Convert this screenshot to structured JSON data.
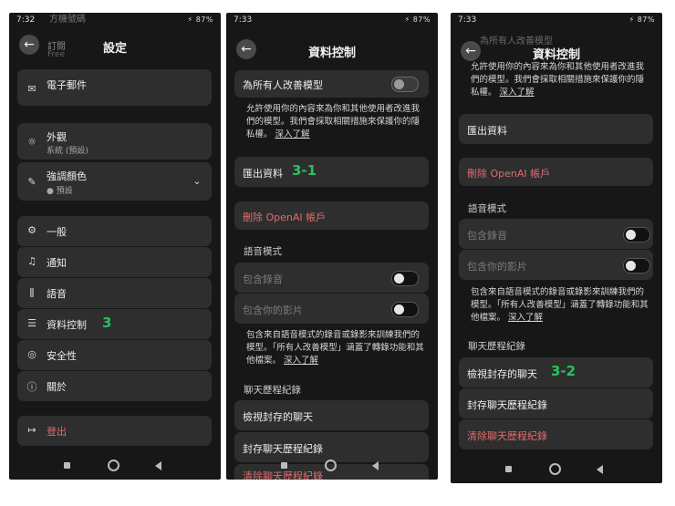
{
  "phone1": {
    "status_time": "7:32",
    "status_right": "⚡ 87%",
    "title": "設定",
    "cut_top_label": "方機號碼",
    "cut_label": "訂閱",
    "cut_sub": "Free",
    "email": "電子郵件",
    "appearance": "外觀",
    "appearance_value": "系統 (預設)",
    "accent": "強調顏色",
    "accent_value": "● 預設",
    "general": "一般",
    "notifications": "通知",
    "voice": "語音",
    "data_controls": "資料控制",
    "data_marker": "3",
    "security": "安全性",
    "about": "關於",
    "logout": "登出"
  },
  "phone2": {
    "status_time": "7:33",
    "status_right": "⚡ 87%",
    "title": "資料控制",
    "improve_model": "為所有人改善模型",
    "improve_desc": "允許使用你的內容來為你和其他使用者改進我們的模型。我們會採取相關措施來保護你的隱私權。",
    "learn_more": "深入了解",
    "export": "匯出資料",
    "export_marker": "3-1",
    "delete_account": "刪除 OpenAI 帳戶",
    "voice_mode": "語音模式",
    "include_audio": "包含錄音",
    "include_video": "包含你的影片",
    "voice_desc": "包含來自語音模式的錄音或錄影來訓練我們的模型。「所有人改善模型」涵蓋了轉錄功能和其他檔案。",
    "learn_more2": "深入了解",
    "chat_history": "聊天歷程紀錄",
    "view_archived": "檢視封存的聊天",
    "archive_history": "封存聊天歷程紀錄",
    "clear_history": "清除聊天歷程紀錄"
  },
  "phone3": {
    "status_time": "7:33",
    "status_right": "⚡ 87%",
    "title": "資料控制",
    "cut_top": "為所有人改善模型",
    "improve_desc": "允許使用你的內容來為你和其他使用者改進我們的模型。我們會採取相關措施來保護你的隱私權。",
    "learn_more": "深入了解",
    "export": "匯出資料",
    "delete_account": "刪除 OpenAI 帳戶",
    "voice_mode": "語音模式",
    "include_audio": "包含錄音",
    "include_video": "包含你的影片",
    "voice_desc": "包含來自語音模式的錄音或錄影來訓練我們的模型。「所有人改善模型」涵蓋了轉錄功能和其他檔案。",
    "learn_more2": "深入了解",
    "chat_history": "聊天歷程紀錄",
    "view_archived": "檢視封存的聊天",
    "view_marker": "3-2",
    "archive_history": "封存聊天歷程紀錄",
    "clear_history": "清除聊天歷程紀錄"
  },
  "colors": {
    "bg": "#171717",
    "card": "#2e2e2e",
    "danger": "#e06c6c",
    "marker": "#27c25b"
  },
  "icons": [
    "back-arrow-icon",
    "mail-icon",
    "sun-icon",
    "brush-icon",
    "chevron-down-icon",
    "gear-icon",
    "bell-icon",
    "waveform-icon",
    "database-icon",
    "shield-icon",
    "info-icon",
    "logout-icon"
  ]
}
